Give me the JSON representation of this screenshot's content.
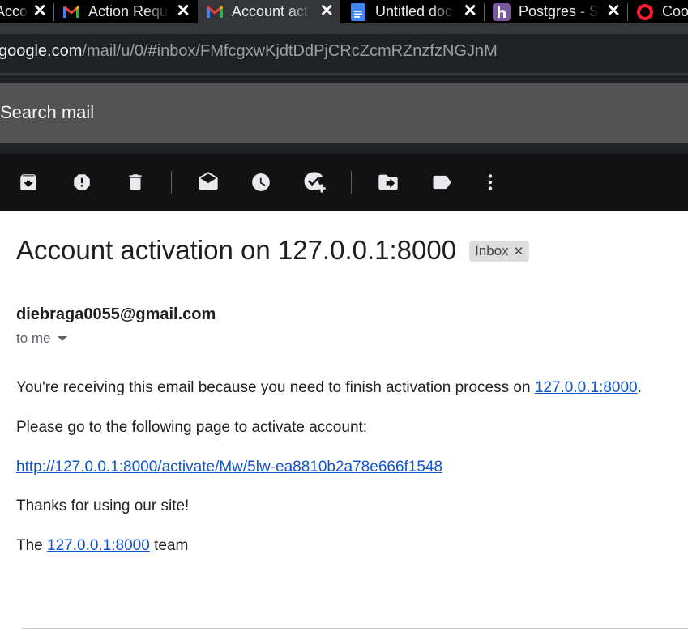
{
  "tabs": [
    {
      "title": "Account act",
      "favicon": "gmail-icon"
    },
    {
      "title": "Action Requ",
      "favicon": "gmail-icon"
    },
    {
      "title": "Account act",
      "favicon": "gmail-icon",
      "active": true
    },
    {
      "title": "Untitled doc",
      "favicon": "google-docs-icon"
    },
    {
      "title": "Postgres - S",
      "favicon": "heroku-icon"
    },
    {
      "title": "Coo",
      "favicon": "opera-icon"
    }
  ],
  "address_bar": {
    "host": "google.com",
    "path": "/mail/u/0/#inbox/FMfcgxwKjdtDdPjCRcZcmRZnzfzNGJnM"
  },
  "search": {
    "placeholder": "Search mail"
  },
  "action_toolbar": [
    "archive-icon",
    "report-spam-icon",
    "delete-icon",
    "mark-unread-icon",
    "snooze-icon",
    "add-to-tasks-icon",
    "move-to-icon",
    "labels-icon",
    "more-options-icon"
  ],
  "email": {
    "subject": "Account activation on 127.0.0.1:8000",
    "label": "Inbox",
    "sender": "diebraga0055@gmail.com",
    "recipient": "to me",
    "p1_text": "You're receiving this email because you need to finish activation process on ",
    "p1_link": "127.0.0.1:8000",
    "p1_end": ".",
    "p2": "Please go to the following page to activate account:",
    "activation_link": "http://127.0.0.1:8000/activate/Mw/5lw-ea8810b2a78e666f1548",
    "p4": "Thanks for using our site!",
    "p5_start": "The ",
    "p5_link": "127.0.0.1:8000",
    "p5_end": " team"
  },
  "colors": {
    "link": "#1155cc",
    "chip_bg": "#dddddd",
    "toolbar_bg": "#121212"
  }
}
